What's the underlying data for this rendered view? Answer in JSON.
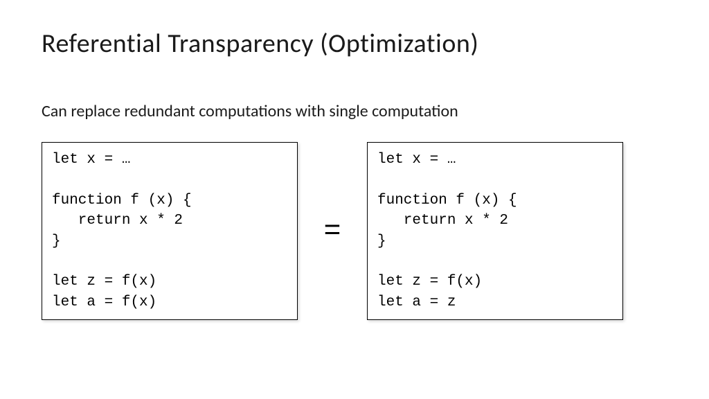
{
  "title": "Referential Transparency (Optimization)",
  "subtitle": "Can replace redundant computations with single computation",
  "equals": "=",
  "left_code": "let x = …\n\nfunction f (x) {\n   return x * 2\n}\n\nlet z = f(x)\nlet a = f(x)",
  "right_code": "let x = …\n\nfunction f (x) {\n   return x * 2\n}\n\nlet z = f(x)\nlet a = z"
}
